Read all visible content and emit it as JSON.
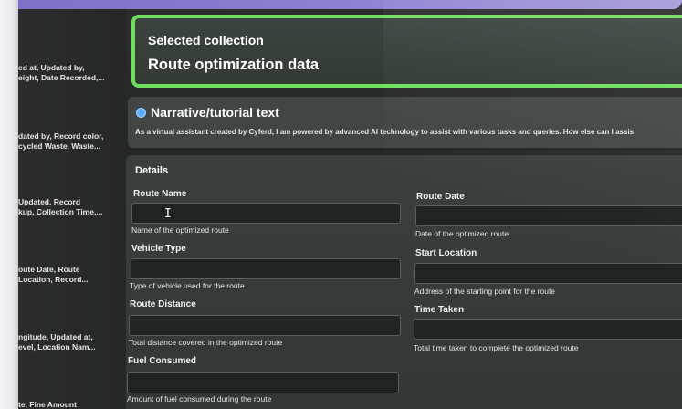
{
  "sidebar": {
    "items": [
      {
        "line1": "ed at, Updated by,",
        "line2": "eight, Date Recorded,..."
      },
      {
        "line1": "dated by, Record color,",
        "line2": "cycled Waste, Waste..."
      },
      {
        "line1": "Updated, Record",
        "line2": "kup, Collection Time,..."
      },
      {
        "line1": "oute Date, Route",
        "line2": "Location, Record..."
      },
      {
        "line1": "ngitude, Updated at,",
        "line2": "evel, Location Nam..."
      },
      {
        "line1": "te, Fine Amount",
        "line2": ""
      }
    ]
  },
  "selected": {
    "label": "Selected collection",
    "title": "Route optimization data"
  },
  "narrative": {
    "title": "Narrative/tutorial text",
    "text": "As a virtual assistant created by Cyferd, I am powered by advanced AI technology to assist with various tasks and queries. How else can I assis"
  },
  "details": {
    "title": "Details",
    "fields": {
      "route_name": {
        "label": "Route Name",
        "value": "",
        "help": "Name of the optimized route"
      },
      "route_date": {
        "label": "Route Date",
        "value": "",
        "help": "Date of the optimized route"
      },
      "vehicle_type": {
        "label": "Vehicle Type",
        "value": "",
        "help": "Type of vehicle used for the route"
      },
      "start_location": {
        "label": "Start Location",
        "value": "",
        "help": "Address of the starting point for the route"
      },
      "route_distance": {
        "label": "Route Distance",
        "value": "",
        "help": "Total distance covered in the optimized route"
      },
      "time_taken": {
        "label": "Time Taken",
        "value": "",
        "help": "Total time taken to complete the optimized route"
      },
      "fuel_consumed": {
        "label": "Fuel Consumed",
        "value": "",
        "help": "Amount of fuel consumed during the route"
      }
    }
  },
  "colors": {
    "highlight_border": "#6fe05d",
    "info_icon": "#5fb1ff"
  }
}
